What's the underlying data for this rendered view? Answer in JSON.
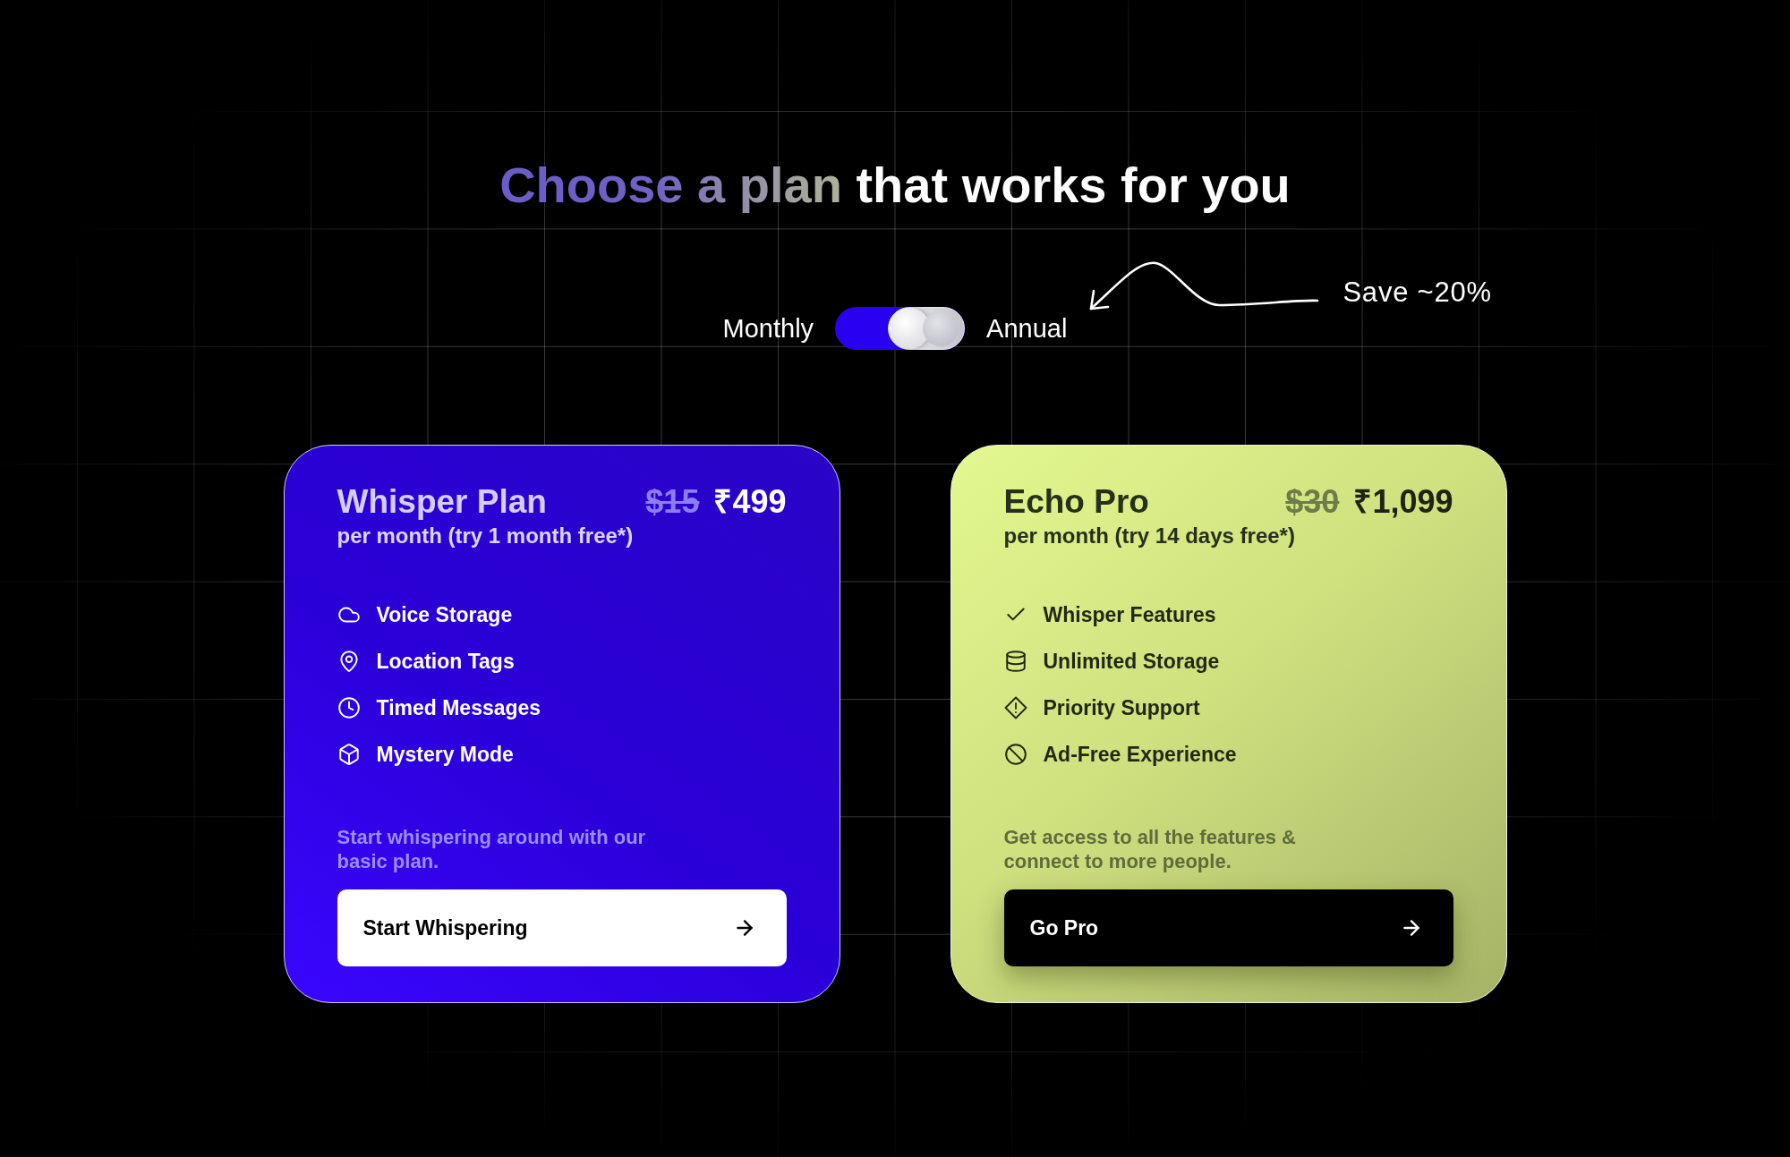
{
  "heading": "Choose a plan that works for you",
  "billing_toggle": {
    "options": [
      {
        "label": "Monthly",
        "selected": false
      },
      {
        "label": "Annual",
        "selected": true
      }
    ]
  },
  "savings_note": "Save ~20%",
  "plans": [
    {
      "kind": "basic",
      "name": "Whisper Plan",
      "old_price": "$15",
      "price": "₹499",
      "period": "per month (try 1 month free*)",
      "features": [
        "Voice Storage",
        "Location Tags",
        "Timed Messages",
        "Mystery Mode"
      ],
      "description": "Start whispering around with our basic plan.",
      "button": "Start Whispering"
    },
    {
      "kind": "pro",
      "name": "Echo Pro",
      "old_price": "$30",
      "price": "₹1,099",
      "period": "per month (try 14 days free*)",
      "features": [
        "Whisper Features",
        "Unlimited Storage",
        "Priority Support",
        "Ad-Free Experience"
      ],
      "description": "Get access to all the features & connect to more people.",
      "button": "Go Pro"
    }
  ]
}
